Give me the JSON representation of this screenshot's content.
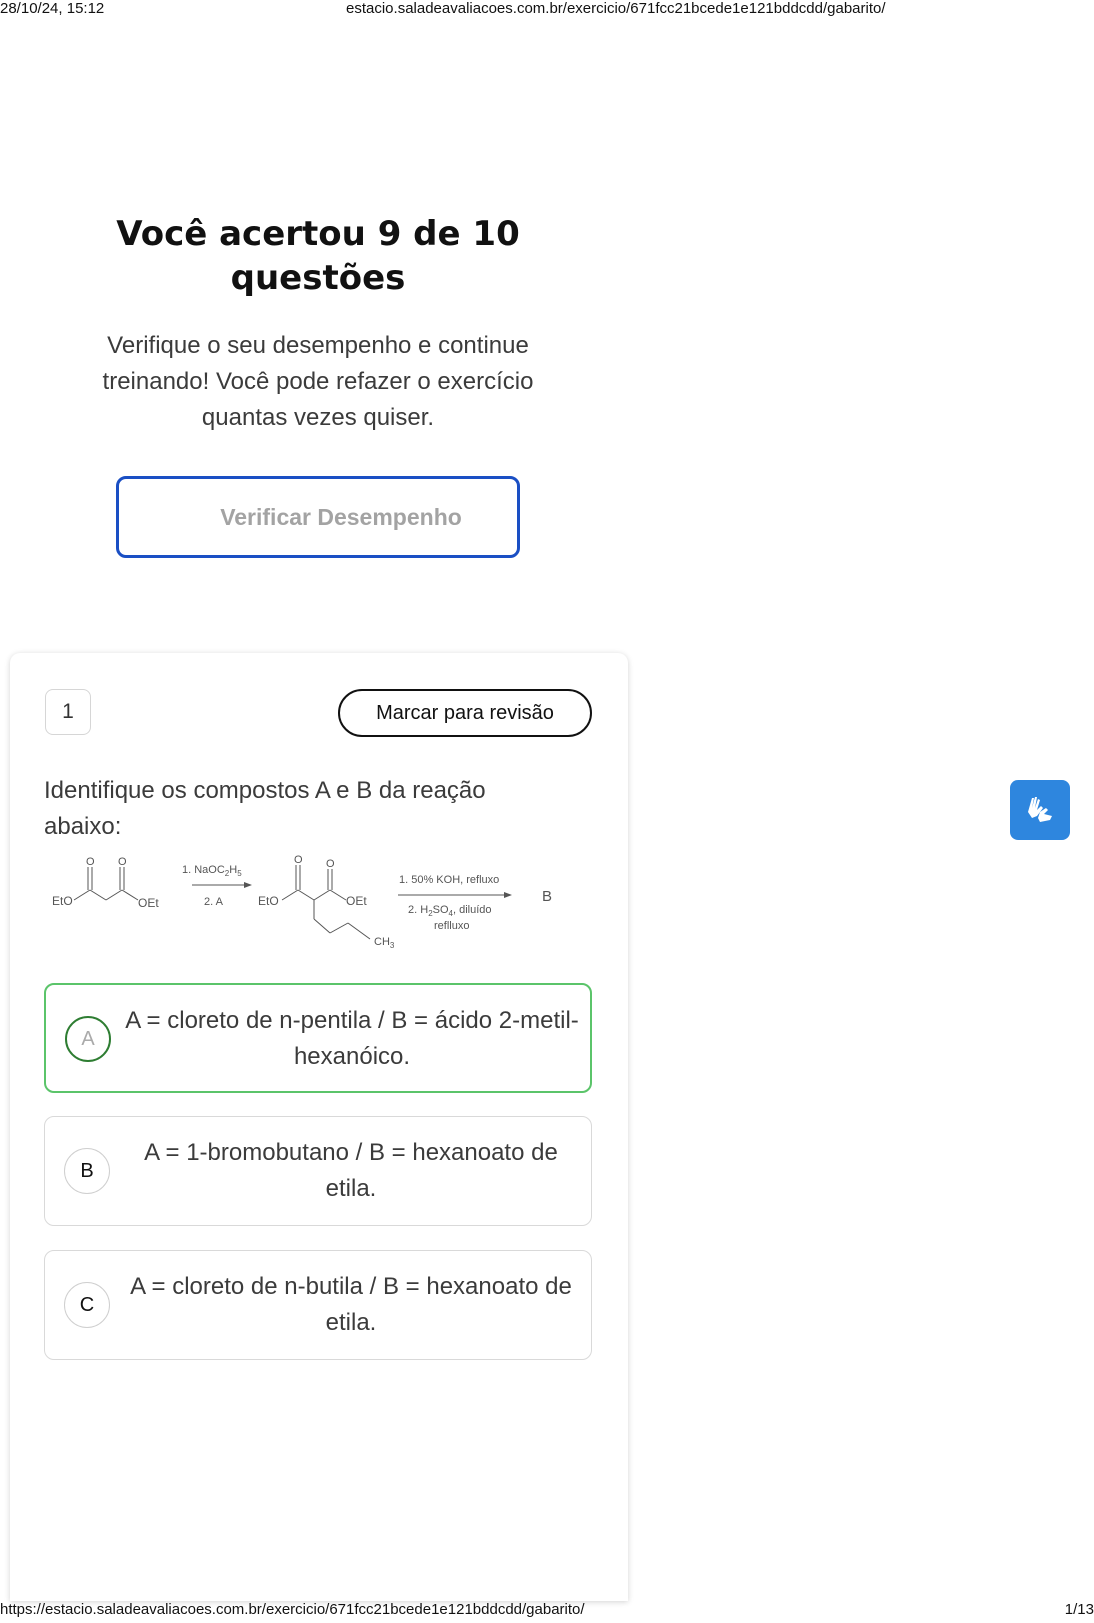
{
  "print": {
    "datetime": "28/10/24, 15:12",
    "header_url": "estacio.saladeavaliacoes.com.br/exercicio/671fcc21bcede1e121bddcdd/gabarito/",
    "footer_url": "https://estacio.saladeavaliacoes.com.br/exercicio/671fcc21bcede1e121bddcdd/gabarito/",
    "page": "1/13"
  },
  "result": {
    "title": "Você acertou 9 de 10 questões",
    "subtitle": "Verifique o seu desempenho e continue treinando! Você pode refazer o exercício quantas vezes quiser.",
    "button_label": "Verificar Desempenho"
  },
  "question": {
    "number": "1",
    "review_label": "Marcar para revisão",
    "text": "Identifique os compostos A e B da reação abaixo:",
    "reaction": {
      "reactant_left": "EtO",
      "reactant_right": "OEt",
      "carbonyl_o": "O",
      "step1_a": "1. NaOC",
      "step1_sub1": "2",
      "step1_h": "H",
      "step1_sub2": "5",
      "step1_b": "2. A",
      "product_left": "EtO",
      "product_right": "OEt",
      "ch3": "CH",
      "ch3_sub": "3",
      "step2_a": "1. 50% KOH, refluxo",
      "step2_b1": "2. H",
      "step2_b_sub1": "2",
      "step2_b2": "SO",
      "step2_b_sub2": "4",
      "step2_b3": ", diluído",
      "step2_c": "reflluxo",
      "final": "B"
    },
    "options": [
      {
        "letter": "A",
        "text": "A = cloreto de n-pentila / B = ácido 2-metil-hexanóico.",
        "state": "correct"
      },
      {
        "letter": "B",
        "text": "A = 1-bromobutano / B = hexanoato de etila.",
        "state": "default"
      },
      {
        "letter": "C",
        "text": "A = cloreto de n-butila / B = hexanoato de etila.",
        "state": "default"
      }
    ]
  },
  "accessibility": {
    "icon": "sign-language-icon",
    "color": "#2e86de"
  }
}
